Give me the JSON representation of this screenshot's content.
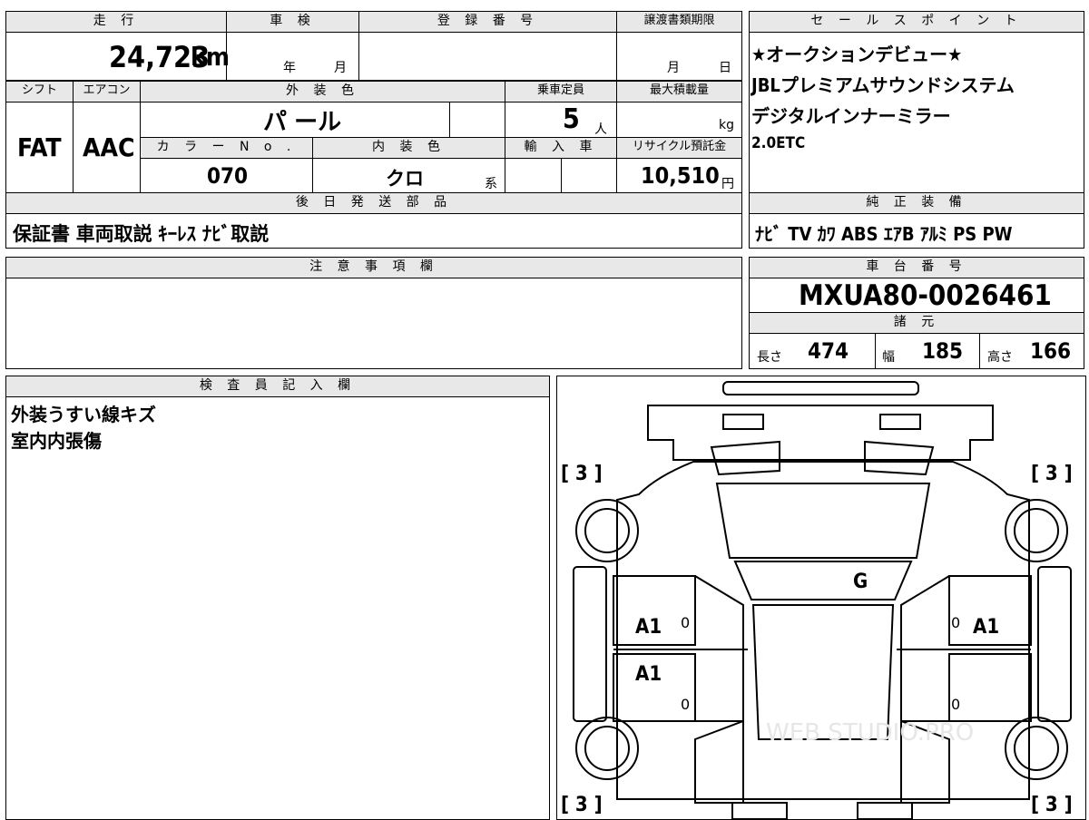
{
  "basic": {
    "mileage_label": "走 行",
    "mileage": "24,723",
    "mileage_unit": "km",
    "shaken_label": "車 検",
    "year_unit": "年",
    "month_unit": "月",
    "registration_label": "登 録 番 号",
    "transfer_deadline_label": "譲渡書類期限",
    "deadline_month": "月",
    "deadline_day": "日",
    "shift_label": "シフト",
    "shift": "FAT",
    "aircon_label": "エアコン",
    "aircon": "AAC",
    "exterior_color_label": "外 装 色",
    "exterior_color": "パ ール",
    "color_no_label": "カ ラ ー N o .",
    "color_no": "070",
    "interior_color_label": "内 装 色",
    "interior_color": "クロ",
    "interior_suffix": "系",
    "capacity_label": "乗車定員",
    "capacity": "5",
    "capacity_unit": "人",
    "max_load_label": "最大積載量",
    "max_load_unit": "kg",
    "import_label": "輸 入 車",
    "recycle_label": "リサイクル預託金",
    "recycle_fee": "10,510",
    "recycle_unit": "円"
  },
  "sales_points": {
    "label": "セ ー ル ス ポ イ ン ト",
    "lines": [
      "★オークションデビュー★",
      "JBLプレミアムサウンドシステム",
      "デジタルインナーミラー",
      "2.0ETC"
    ]
  },
  "later_parts": {
    "label": "後 日 発 送 部 品",
    "value": "保証書 車両取説 ｷｰﾚｽ ﾅﾋﾞ取説"
  },
  "equipment": {
    "label": "純 正 装 備",
    "value": "ﾅﾋﾞ TV ｶﾜ ABS ｴｱB ｱﾙﾐ PS PW"
  },
  "notes": {
    "label": "注 意 事 項 欄",
    "value": ""
  },
  "chassis": {
    "label": "車 台 番 号",
    "number": "MXUA80-0026461"
  },
  "specs": {
    "label": "諸 元",
    "length_label": "長さ",
    "length": "474",
    "width_label": "幅",
    "width": "185",
    "height_label": "高さ",
    "height": "166"
  },
  "inspector": {
    "label": "検 査 員 記 入 欄",
    "lines": [
      "外装うすい線キズ",
      "室内内張傷"
    ]
  },
  "diagram": {
    "tire_fl": "[ 3 ]",
    "tire_fr": "[ 3 ]",
    "tire_rl": "[ 3 ]",
    "tire_rr": "[ 3 ]",
    "windshield": "G",
    "front_left_door": "A1",
    "rear_left_door": "A1",
    "front_right_door": "A1",
    "zero": "0",
    "watermark": "WEB STUDIO.PRO"
  }
}
